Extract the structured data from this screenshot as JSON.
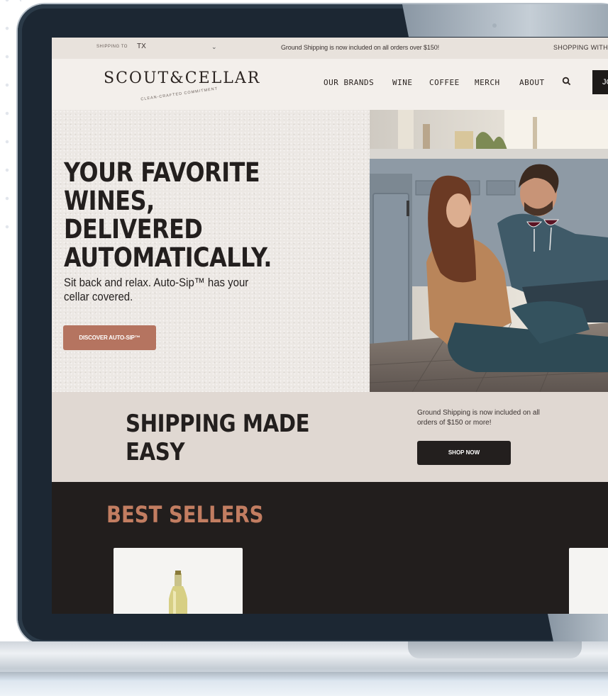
{
  "topbar": {
    "shipping_label": "SHIPPING TO",
    "shipping_state": "TX",
    "promo": "Ground Shipping is now included on all orders over $150!",
    "shop_with": "SHOPPING WITH A"
  },
  "header": {
    "logo_text": "SCOUT&CELLAR",
    "logo_tagline": "CLEAN-CRAFTED COMMITMENT",
    "nav": [
      "OUR BRANDS",
      "WINE",
      "COFFEE",
      "MERCH",
      "ABOUT"
    ],
    "join_label": "JO"
  },
  "hero": {
    "title": "YOUR FAVORITE\nWINES, DELIVERED\nAUTOMATICALLY.",
    "subtitle": "Sit back and relax. Auto-Sip™ has your\ncellar covered.",
    "button": "DISCOVER AUTO-SIP™"
  },
  "shipping": {
    "title": "SHIPPING MADE\nEASY",
    "text": "Ground Shipping is now included on all orders of $150 or more!",
    "button": "SHOP NOW"
  },
  "best_sellers": {
    "title": "BEST SELLERS"
  },
  "colors": {
    "accent": "#b57460",
    "dark": "#231f1e",
    "bezel": "#1c2733"
  },
  "icons": [
    "search-icon",
    "chevron-down-icon",
    "camera-icon"
  ]
}
